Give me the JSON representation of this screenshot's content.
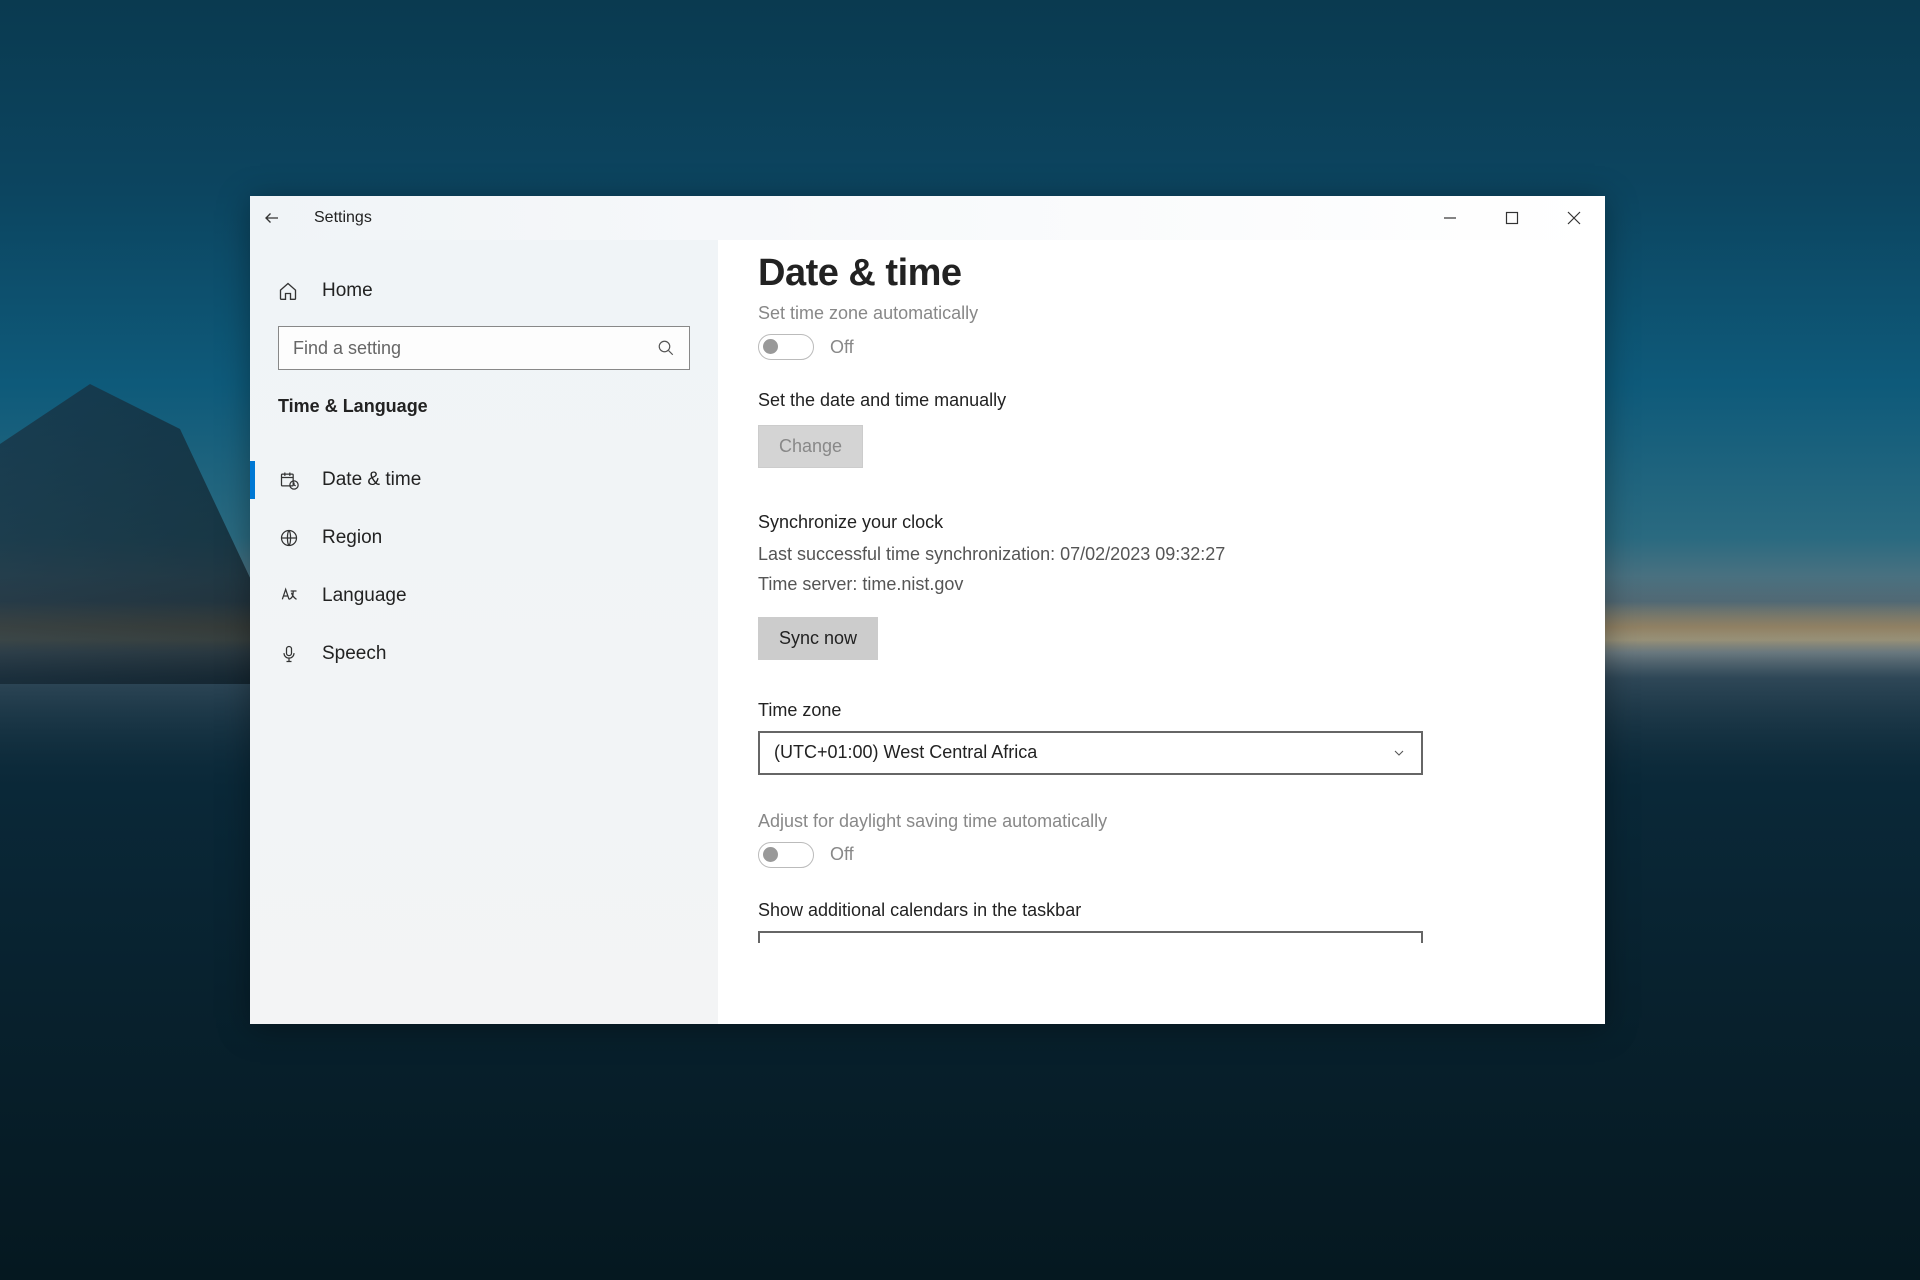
{
  "window": {
    "title": "Settings"
  },
  "sidebar": {
    "home_label": "Home",
    "search_placeholder": "Find a setting",
    "category_label": "Time & Language",
    "items": [
      {
        "label": "Date & time"
      },
      {
        "label": "Region"
      },
      {
        "label": "Language"
      },
      {
        "label": "Speech"
      }
    ]
  },
  "content": {
    "heading": "Date & time",
    "auto_tz": {
      "label": "Set time zone automatically",
      "state": "Off"
    },
    "manual_datetime": {
      "label": "Set the date and time manually",
      "button": "Change"
    },
    "sync": {
      "heading": "Synchronize your clock",
      "last_sync": "Last successful time synchronization: 07/02/2023 09:32:27",
      "server": "Time server: time.nist.gov",
      "button": "Sync now"
    },
    "timezone": {
      "label": "Time zone",
      "value": "(UTC+01:00) West Central Africa"
    },
    "dst": {
      "label": "Adjust for daylight saving time automatically",
      "state": "Off"
    },
    "additional_calendars": {
      "label": "Show additional calendars in the taskbar"
    }
  }
}
